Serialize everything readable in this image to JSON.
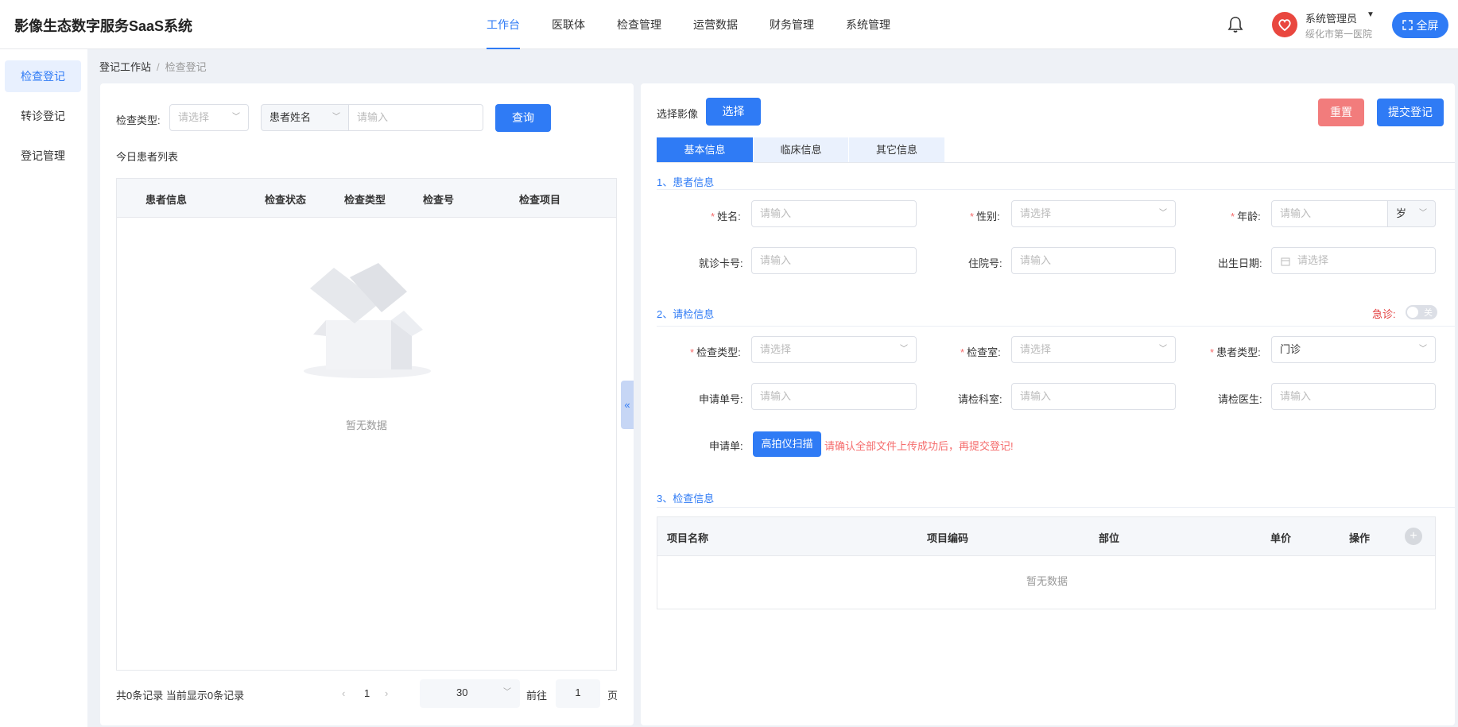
{
  "header": {
    "app_title": "影像生态数字服务SaaS系统",
    "nav": [
      "工作台",
      "医联体",
      "检查管理",
      "运营数据",
      "财务管理",
      "系统管理"
    ],
    "active_nav": "工作台",
    "user_name": "系统管理员",
    "user_org": "绥化市第一医院",
    "fullscreen_label": "全屏",
    "accent_color": "#2f7bf5"
  },
  "sidebar": {
    "items": [
      "检查登记",
      "转诊登记",
      "登记管理"
    ],
    "active": "检查登记"
  },
  "breadcrumb": {
    "root": "登记工作站",
    "sep": "/",
    "current": "检查登记"
  },
  "left_panel": {
    "exam_type_label": "检查类型:",
    "exam_type_placeholder": "请选择",
    "search_field": "患者姓名",
    "search_placeholder": "请输入",
    "query_label": "查询",
    "list_title": "今日患者列表",
    "columns": [
      "患者信息",
      "检查状态",
      "检查类型",
      "检查号",
      "检查项目"
    ],
    "empty_text": "暂无数据",
    "summary": "共0条记录 当前显示0条记录",
    "page": "1",
    "page_size": "30",
    "goto_label": "前往",
    "goto_value": "1",
    "page_suffix": "页"
  },
  "right_panel": {
    "select_image_label": "选择影像",
    "select_button": "选择",
    "reset_button": "重置",
    "submit_button": "提交登记",
    "tabs": [
      "基本信息",
      "临床信息",
      "其它信息"
    ],
    "active_tab": "基本信息",
    "section1": {
      "title": "1、患者信息",
      "name_label": "姓名:",
      "name_placeholder": "请输入",
      "gender_label": "性别:",
      "gender_placeholder": "请选择",
      "age_label": "年龄:",
      "age_placeholder": "请输入",
      "age_unit": "岁",
      "card_label": "就诊卡号:",
      "card_placeholder": "请输入",
      "inpatient_label": "住院号:",
      "inpatient_placeholder": "请输入",
      "birth_label": "出生日期:",
      "birth_placeholder": "请选择"
    },
    "section2": {
      "title": "2、请检信息",
      "emergency_label": "急诊:",
      "emergency_toggle": "关",
      "exam_type_label": "检查类型:",
      "exam_type_placeholder": "请选择",
      "room_label": "检查室:",
      "room_placeholder": "请选择",
      "patient_type_label": "患者类型:",
      "patient_type_value": "门诊",
      "apply_no_label": "申请单号:",
      "apply_no_placeholder": "请输入",
      "dept_label": "请检科室:",
      "dept_placeholder": "请输入",
      "doctor_label": "请检医生:",
      "doctor_placeholder": "请输入",
      "form_label": "申请单:",
      "scan_button": "高拍仪扫描",
      "warning": "请确认全部文件上传成功后，再提交登记!"
    },
    "section3": {
      "title": "3、检查信息",
      "columns": [
        "项目名称",
        "项目编码",
        "部位",
        "单价",
        "操作"
      ],
      "empty_text": "暂无数据"
    }
  }
}
